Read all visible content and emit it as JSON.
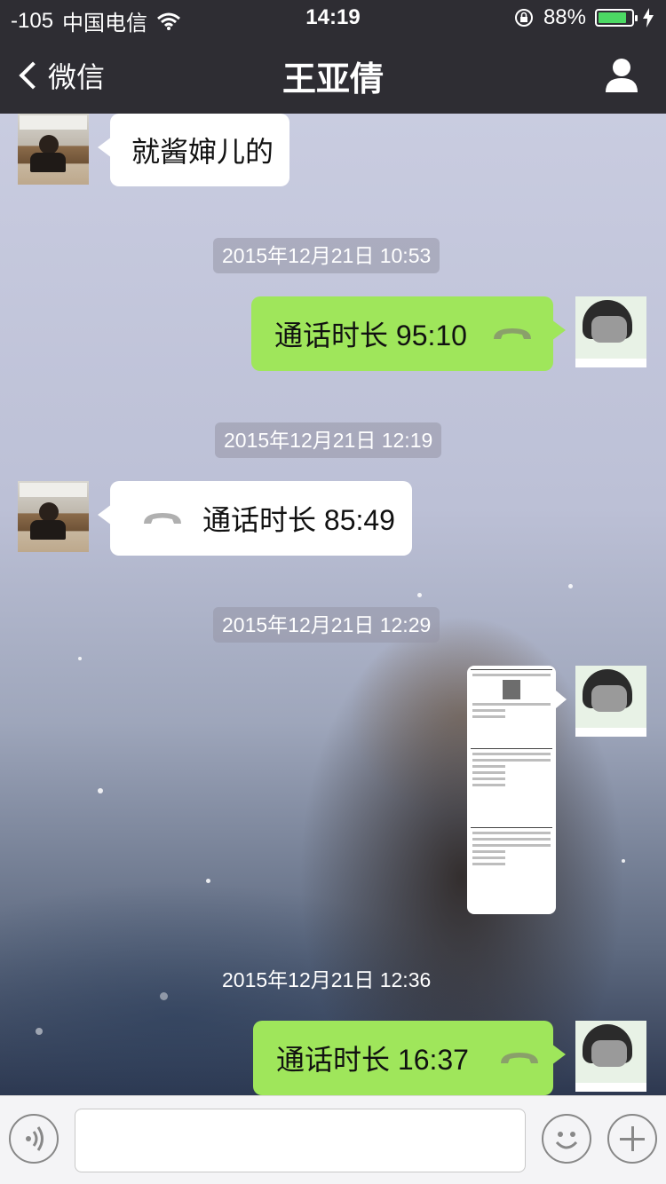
{
  "status_bar": {
    "signal": "-105",
    "carrier": "中国电信",
    "time": "14:19",
    "battery": "88%",
    "battery_level": 0.88
  },
  "nav": {
    "back_label": "微信",
    "title": "王亚倩"
  },
  "messages": {
    "m1": {
      "text": "就酱婶儿的",
      "side": "left"
    },
    "ts1": "2015年12月21日 10:53",
    "m2": {
      "text": "通话时长 95:10",
      "side": "right"
    },
    "ts2": "2015年12月21日 12:19",
    "m3": {
      "text": "通话时长 85:49",
      "side": "left"
    },
    "ts3": "2015年12月21日 12:29",
    "ts4": "2015年12月21日 12:36",
    "m5": {
      "text": "通话时长 16:37",
      "side": "right"
    }
  },
  "colors": {
    "bar": "#2e2d33",
    "green_bubble": "#9fe65b",
    "white_bubble": "#ffffff"
  },
  "icons": {
    "phone": "phone-hangup-icon",
    "profile": "person-icon",
    "voice": "voice-icon",
    "emoji": "smile-icon",
    "more": "plus-icon"
  }
}
